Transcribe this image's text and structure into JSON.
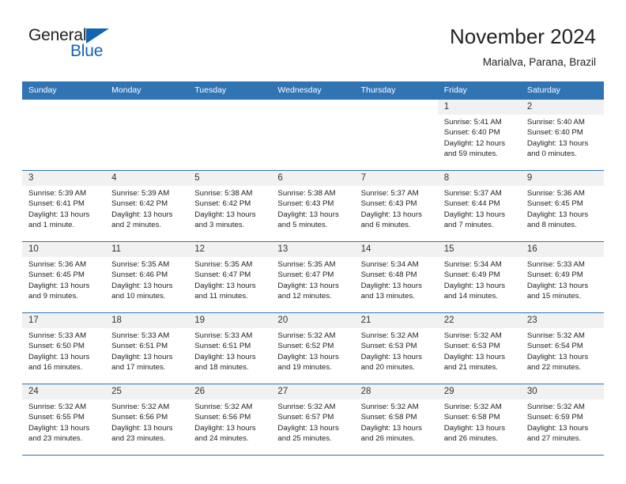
{
  "brand": {
    "name_top": "General",
    "name_bottom": "Blue"
  },
  "header": {
    "title": "November 2024",
    "subtitle": "Marialva, Parana, Brazil"
  },
  "theme": {
    "header_blue": "#3174b4",
    "brand_blue": "#1464b4",
    "daynum_band": "#f1f1f1"
  },
  "calendar": {
    "weekday_headers": [
      "Sunday",
      "Monday",
      "Tuesday",
      "Wednesday",
      "Thursday",
      "Friday",
      "Saturday"
    ],
    "weeks": [
      [
        {
          "day": "",
          "blank": true,
          "sunrise": "",
          "sunset": "",
          "daylight_line1": "",
          "daylight_line2": ""
        },
        {
          "day": "",
          "blank": true,
          "sunrise": "",
          "sunset": "",
          "daylight_line1": "",
          "daylight_line2": ""
        },
        {
          "day": "",
          "blank": true,
          "sunrise": "",
          "sunset": "",
          "daylight_line1": "",
          "daylight_line2": ""
        },
        {
          "day": "",
          "blank": true,
          "sunrise": "",
          "sunset": "",
          "daylight_line1": "",
          "daylight_line2": ""
        },
        {
          "day": "",
          "blank": true,
          "sunrise": "",
          "sunset": "",
          "daylight_line1": "",
          "daylight_line2": ""
        },
        {
          "day": "1",
          "blank": false,
          "sunrise": "Sunrise: 5:41 AM",
          "sunset": "Sunset: 6:40 PM",
          "daylight_line1": "Daylight: 12 hours",
          "daylight_line2": "and 59 minutes."
        },
        {
          "day": "2",
          "blank": false,
          "sunrise": "Sunrise: 5:40 AM",
          "sunset": "Sunset: 6:40 PM",
          "daylight_line1": "Daylight: 13 hours",
          "daylight_line2": "and 0 minutes."
        }
      ],
      [
        {
          "day": "3",
          "blank": false,
          "sunrise": "Sunrise: 5:39 AM",
          "sunset": "Sunset: 6:41 PM",
          "daylight_line1": "Daylight: 13 hours",
          "daylight_line2": "and 1 minute."
        },
        {
          "day": "4",
          "blank": false,
          "sunrise": "Sunrise: 5:39 AM",
          "sunset": "Sunset: 6:42 PM",
          "daylight_line1": "Daylight: 13 hours",
          "daylight_line2": "and 2 minutes."
        },
        {
          "day": "5",
          "blank": false,
          "sunrise": "Sunrise: 5:38 AM",
          "sunset": "Sunset: 6:42 PM",
          "daylight_line1": "Daylight: 13 hours",
          "daylight_line2": "and 3 minutes."
        },
        {
          "day": "6",
          "blank": false,
          "sunrise": "Sunrise: 5:38 AM",
          "sunset": "Sunset: 6:43 PM",
          "daylight_line1": "Daylight: 13 hours",
          "daylight_line2": "and 5 minutes."
        },
        {
          "day": "7",
          "blank": false,
          "sunrise": "Sunrise: 5:37 AM",
          "sunset": "Sunset: 6:43 PM",
          "daylight_line1": "Daylight: 13 hours",
          "daylight_line2": "and 6 minutes."
        },
        {
          "day": "8",
          "blank": false,
          "sunrise": "Sunrise: 5:37 AM",
          "sunset": "Sunset: 6:44 PM",
          "daylight_line1": "Daylight: 13 hours",
          "daylight_line2": "and 7 minutes."
        },
        {
          "day": "9",
          "blank": false,
          "sunrise": "Sunrise: 5:36 AM",
          "sunset": "Sunset: 6:45 PM",
          "daylight_line1": "Daylight: 13 hours",
          "daylight_line2": "and 8 minutes."
        }
      ],
      [
        {
          "day": "10",
          "blank": false,
          "sunrise": "Sunrise: 5:36 AM",
          "sunset": "Sunset: 6:45 PM",
          "daylight_line1": "Daylight: 13 hours",
          "daylight_line2": "and 9 minutes."
        },
        {
          "day": "11",
          "blank": false,
          "sunrise": "Sunrise: 5:35 AM",
          "sunset": "Sunset: 6:46 PM",
          "daylight_line1": "Daylight: 13 hours",
          "daylight_line2": "and 10 minutes."
        },
        {
          "day": "12",
          "blank": false,
          "sunrise": "Sunrise: 5:35 AM",
          "sunset": "Sunset: 6:47 PM",
          "daylight_line1": "Daylight: 13 hours",
          "daylight_line2": "and 11 minutes."
        },
        {
          "day": "13",
          "blank": false,
          "sunrise": "Sunrise: 5:35 AM",
          "sunset": "Sunset: 6:47 PM",
          "daylight_line1": "Daylight: 13 hours",
          "daylight_line2": "and 12 minutes."
        },
        {
          "day": "14",
          "blank": false,
          "sunrise": "Sunrise: 5:34 AM",
          "sunset": "Sunset: 6:48 PM",
          "daylight_line1": "Daylight: 13 hours",
          "daylight_line2": "and 13 minutes."
        },
        {
          "day": "15",
          "blank": false,
          "sunrise": "Sunrise: 5:34 AM",
          "sunset": "Sunset: 6:49 PM",
          "daylight_line1": "Daylight: 13 hours",
          "daylight_line2": "and 14 minutes."
        },
        {
          "day": "16",
          "blank": false,
          "sunrise": "Sunrise: 5:33 AM",
          "sunset": "Sunset: 6:49 PM",
          "daylight_line1": "Daylight: 13 hours",
          "daylight_line2": "and 15 minutes."
        }
      ],
      [
        {
          "day": "17",
          "blank": false,
          "sunrise": "Sunrise: 5:33 AM",
          "sunset": "Sunset: 6:50 PM",
          "daylight_line1": "Daylight: 13 hours",
          "daylight_line2": "and 16 minutes."
        },
        {
          "day": "18",
          "blank": false,
          "sunrise": "Sunrise: 5:33 AM",
          "sunset": "Sunset: 6:51 PM",
          "daylight_line1": "Daylight: 13 hours",
          "daylight_line2": "and 17 minutes."
        },
        {
          "day": "19",
          "blank": false,
          "sunrise": "Sunrise: 5:33 AM",
          "sunset": "Sunset: 6:51 PM",
          "daylight_line1": "Daylight: 13 hours",
          "daylight_line2": "and 18 minutes."
        },
        {
          "day": "20",
          "blank": false,
          "sunrise": "Sunrise: 5:32 AM",
          "sunset": "Sunset: 6:52 PM",
          "daylight_line1": "Daylight: 13 hours",
          "daylight_line2": "and 19 minutes."
        },
        {
          "day": "21",
          "blank": false,
          "sunrise": "Sunrise: 5:32 AM",
          "sunset": "Sunset: 6:53 PM",
          "daylight_line1": "Daylight: 13 hours",
          "daylight_line2": "and 20 minutes."
        },
        {
          "day": "22",
          "blank": false,
          "sunrise": "Sunrise: 5:32 AM",
          "sunset": "Sunset: 6:53 PM",
          "daylight_line1": "Daylight: 13 hours",
          "daylight_line2": "and 21 minutes."
        },
        {
          "day": "23",
          "blank": false,
          "sunrise": "Sunrise: 5:32 AM",
          "sunset": "Sunset: 6:54 PM",
          "daylight_line1": "Daylight: 13 hours",
          "daylight_line2": "and 22 minutes."
        }
      ],
      [
        {
          "day": "24",
          "blank": false,
          "sunrise": "Sunrise: 5:32 AM",
          "sunset": "Sunset: 6:55 PM",
          "daylight_line1": "Daylight: 13 hours",
          "daylight_line2": "and 23 minutes."
        },
        {
          "day": "25",
          "blank": false,
          "sunrise": "Sunrise: 5:32 AM",
          "sunset": "Sunset: 6:56 PM",
          "daylight_line1": "Daylight: 13 hours",
          "daylight_line2": "and 23 minutes."
        },
        {
          "day": "26",
          "blank": false,
          "sunrise": "Sunrise: 5:32 AM",
          "sunset": "Sunset: 6:56 PM",
          "daylight_line1": "Daylight: 13 hours",
          "daylight_line2": "and 24 minutes."
        },
        {
          "day": "27",
          "blank": false,
          "sunrise": "Sunrise: 5:32 AM",
          "sunset": "Sunset: 6:57 PM",
          "daylight_line1": "Daylight: 13 hours",
          "daylight_line2": "and 25 minutes."
        },
        {
          "day": "28",
          "blank": false,
          "sunrise": "Sunrise: 5:32 AM",
          "sunset": "Sunset: 6:58 PM",
          "daylight_line1": "Daylight: 13 hours",
          "daylight_line2": "and 26 minutes."
        },
        {
          "day": "29",
          "blank": false,
          "sunrise": "Sunrise: 5:32 AM",
          "sunset": "Sunset: 6:58 PM",
          "daylight_line1": "Daylight: 13 hours",
          "daylight_line2": "and 26 minutes."
        },
        {
          "day": "30",
          "blank": false,
          "sunrise": "Sunrise: 5:32 AM",
          "sunset": "Sunset: 6:59 PM",
          "daylight_line1": "Daylight: 13 hours",
          "daylight_line2": "and 27 minutes."
        }
      ]
    ]
  }
}
